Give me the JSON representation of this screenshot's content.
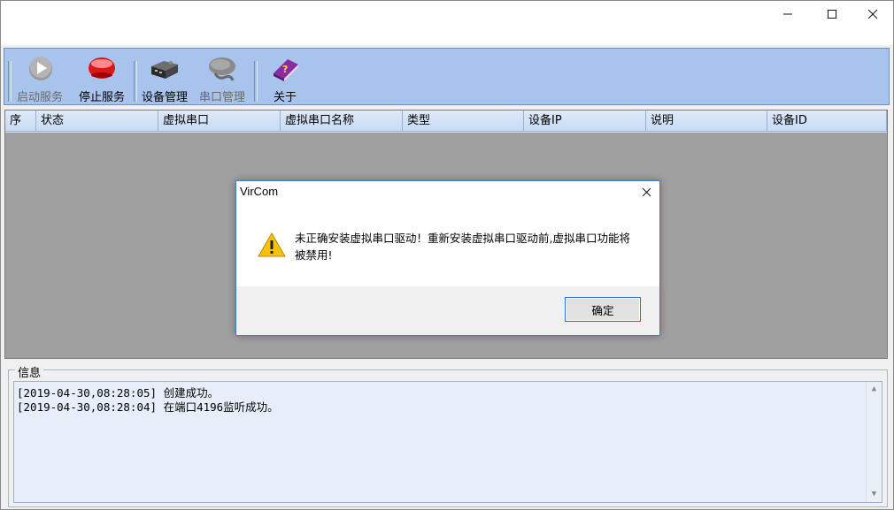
{
  "window": {
    "controls": {
      "minimize": "—",
      "maximize": "☐",
      "close": "✕"
    }
  },
  "toolbar": {
    "start_service": "启动服务",
    "stop_service": "停止服务",
    "device_manage": "设备管理",
    "port_manage": "串口管理",
    "about": "关于"
  },
  "grid": {
    "columns": [
      "序",
      "状态",
      "虚拟串口",
      "虚拟串口名称",
      "类型",
      "设备IP",
      "说明",
      "设备ID"
    ]
  },
  "info": {
    "legend": "信息",
    "log": [
      "[2019-04-30,08:28:05] 创建成功。",
      "[2019-04-30,08:28:04] 在端口4196监听成功。"
    ]
  },
  "dialog": {
    "title": "VirCom",
    "close": "✕",
    "message": "未正确安装虚拟串口驱动！重新安装虚拟串口驱动前,虚拟串口功能将被禁用!",
    "ok_label": "确定"
  },
  "colors": {
    "toolbar_bg": "#a9c4ec",
    "grid_bg": "#a0a0a0",
    "log_bg": "#e6eff9",
    "dialog_border": "#3c7fcf"
  }
}
